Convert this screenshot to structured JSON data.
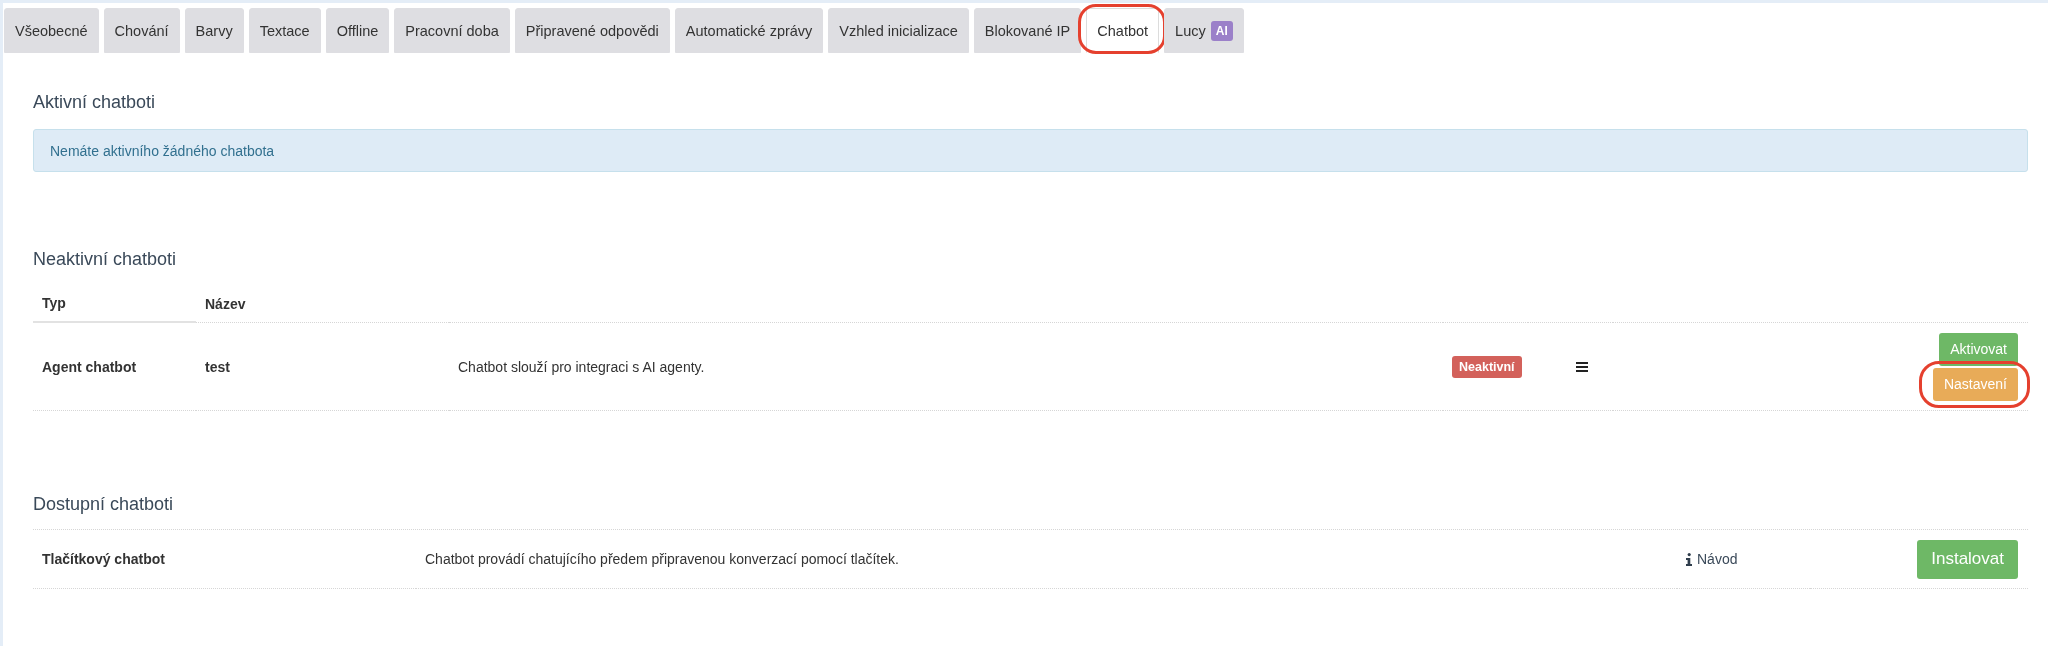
{
  "tabs": [
    {
      "label": "Všeobecné",
      "selected": false,
      "highlighted": false
    },
    {
      "label": "Chování",
      "selected": false,
      "highlighted": false
    },
    {
      "label": "Barvy",
      "selected": false,
      "highlighted": false
    },
    {
      "label": "Textace",
      "selected": false,
      "highlighted": false
    },
    {
      "label": "Offline",
      "selected": false,
      "highlighted": false
    },
    {
      "label": "Pracovní doba",
      "selected": false,
      "highlighted": false
    },
    {
      "label": "Připravené odpovědi",
      "selected": false,
      "highlighted": false
    },
    {
      "label": "Automatické zprávy",
      "selected": false,
      "highlighted": false
    },
    {
      "label": "Vzhled inicializace",
      "selected": false,
      "highlighted": false
    },
    {
      "label": "Blokované IP",
      "selected": false,
      "highlighted": false
    },
    {
      "label": "Chatbot",
      "selected": true,
      "highlighted": true
    },
    {
      "label": "Lucy",
      "badge": "AI",
      "selected": false,
      "highlighted": false
    }
  ],
  "active_section": {
    "title": "Aktivní chatboti",
    "notice": "Nemáte aktivního žádného chatbota"
  },
  "inactive_section": {
    "title": "Neaktivní chatboti",
    "columns": [
      "Typ",
      "Název"
    ],
    "rows": [
      {
        "type": "Agent chatbot",
        "name": "test",
        "description": "Chatbot slouží pro integraci s AI agenty.",
        "status": "Neaktivní",
        "actions": [
          {
            "label": "Aktivovat",
            "kind": "activate",
            "highlighted": false
          },
          {
            "label": "Nastavení",
            "kind": "settings",
            "highlighted": true
          }
        ]
      }
    ]
  },
  "available_section": {
    "title": "Dostupní chatboti",
    "rows": [
      {
        "name": "Tlačítkový chatbot",
        "description": "Chatbot provádí chatujícího předem připravenou konverzací pomocí tlačítek.",
        "guide": "Návod",
        "actions": [
          {
            "label": "Instalovat",
            "kind": "install",
            "highlighted": false
          }
        ]
      }
    ]
  }
}
